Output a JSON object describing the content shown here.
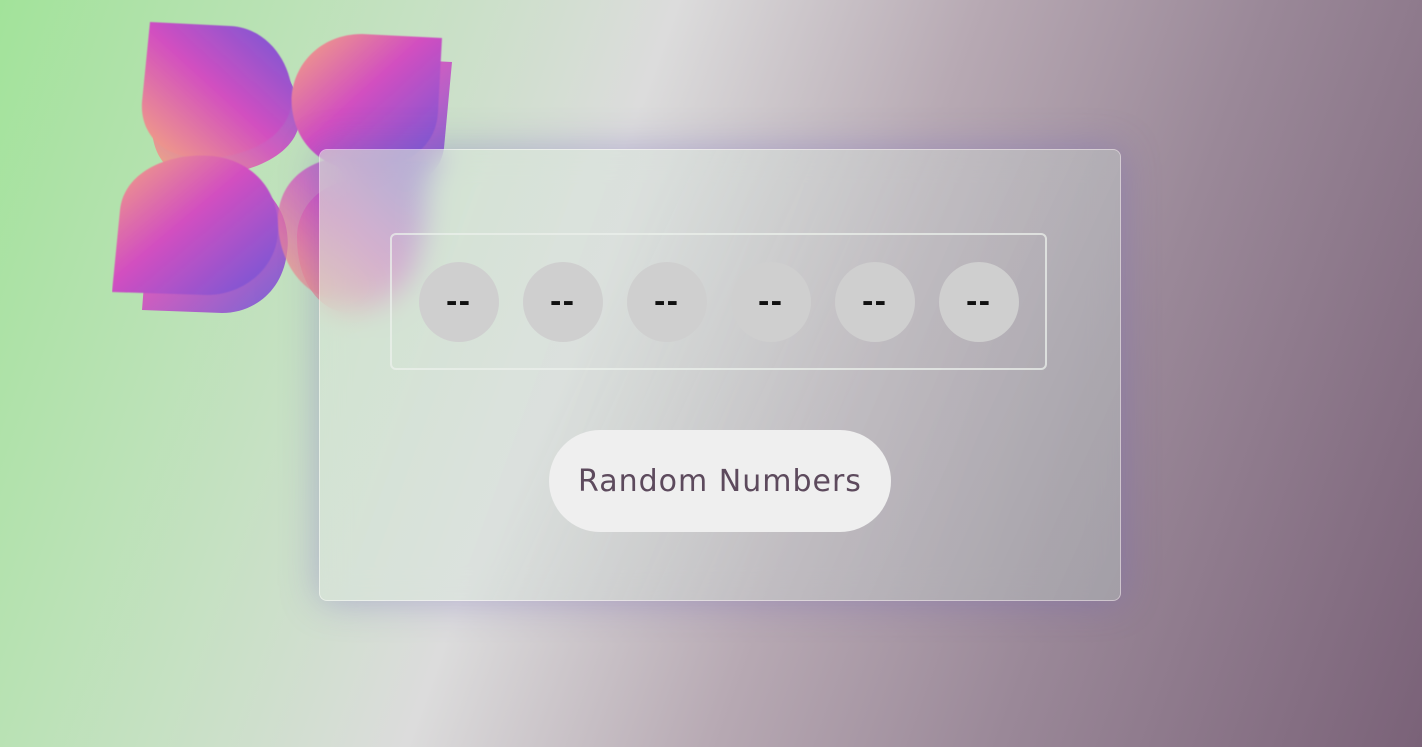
{
  "numbers": {
    "balls": [
      "--",
      "--",
      "--",
      "--",
      "--",
      "--"
    ]
  },
  "button": {
    "label": "Random Numbers"
  },
  "colors": {
    "background_left": "#a2e39a",
    "background_right": "#7a6278",
    "ball": "#cfcfcf",
    "button_bg": "#efefef",
    "button_text": "#5d4a5d",
    "flower_gradient": [
      "#f4a87e",
      "#d24fc0",
      "#6d58d8"
    ]
  }
}
